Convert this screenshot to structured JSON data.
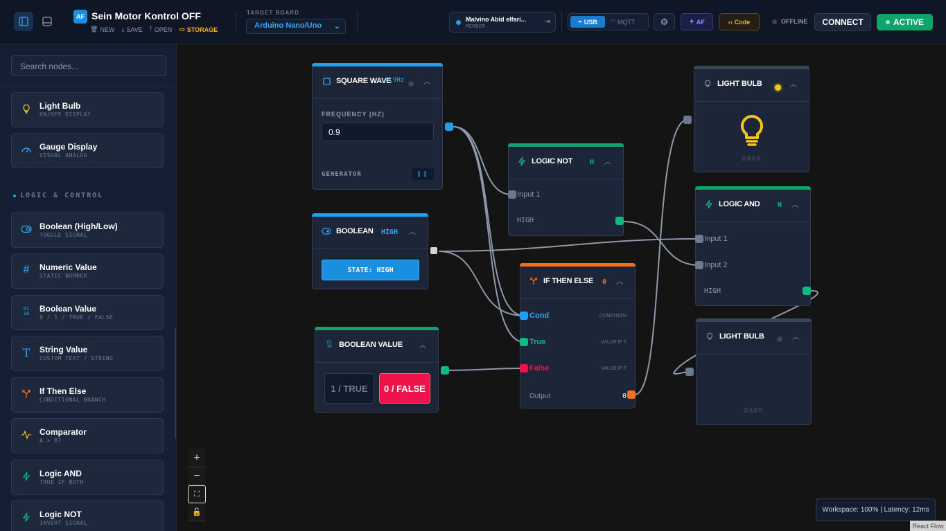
{
  "header": {
    "logo": "AF",
    "title": "Sein Motor Kontrol OFF",
    "actions": {
      "new": "NEW",
      "save": "SAVE",
      "open": "OPEN",
      "storage": "STORAGE"
    },
    "target_label": "TARGET BOARD",
    "target_value": "Arduino Nano/Uno",
    "user_name": "Malvino Abid elfari...",
    "user_role": "MEMBER",
    "usb": "USB",
    "mqtt": "MQTT",
    "af": "AF",
    "code": "Code",
    "status": "OFFLINE",
    "connect": "CONNECT",
    "active": "ACTIVE"
  },
  "sidebar": {
    "search_placeholder": "Search nodes...",
    "section_label": "LOGIC & CONTROL",
    "items": [
      {
        "name": "Light Bulb",
        "sub": "ON/OFF DISPLAY",
        "icon": "bulb-icon"
      },
      {
        "name": "Gauge Display",
        "sub": "VISUAL ANALOG",
        "icon": "gauge-icon"
      },
      {
        "name": "Boolean (High/Low)",
        "sub": "TOGGLE SIGNAL",
        "icon": "toggle-icon"
      },
      {
        "name": "Numeric Value",
        "sub": "STATIC NUMBER",
        "icon": "hash-icon"
      },
      {
        "name": "Boolean Value",
        "sub": "0 / 1 / TRUE / FALSE",
        "icon": "binary-icon"
      },
      {
        "name": "String Value",
        "sub": "CUSTOM TEXT / STRING",
        "icon": "text-icon"
      },
      {
        "name": "If Then Else",
        "sub": "CONDITIONAL BRANCH",
        "icon": "branch-icon"
      },
      {
        "name": "Comparator",
        "sub": "A > B?",
        "icon": "wave-icon"
      },
      {
        "name": "Logic AND",
        "sub": "TRUE IF BOTH",
        "icon": "bolt-icon"
      },
      {
        "name": "Logic NOT",
        "sub": "INVERT SIGNAL",
        "icon": "bolt-icon"
      }
    ]
  },
  "nodes": {
    "square_wave": {
      "title": "SQUARE WAVE",
      "badge": "0.9Hz",
      "freq_label": "FREQUENCY (HZ)",
      "freq_value": "0.9",
      "footer": "GENERATOR"
    },
    "boolean": {
      "title": "BOOLEAN",
      "badge": "HIGH",
      "state": "STATE: HIGH"
    },
    "boolean_value": {
      "title": "BOOLEAN VALUE",
      "true_label": "1 / TRUE",
      "false_label": "0 / FALSE"
    },
    "logic_not": {
      "title": "LOGIC NOT",
      "badge": "H",
      "input": "Input 1",
      "output": "HIGH"
    },
    "if_then_else": {
      "title": "IF THEN ELSE",
      "badge": "0",
      "cond": "Cond",
      "cond_hint": "CONDITION",
      "true_in": "True",
      "true_hint": "VALUE IF T",
      "false_in": "False",
      "false_hint": "VALUE IF F",
      "output": "Output",
      "output_val": "0"
    },
    "light_bulb_1": {
      "title": "LIGHT BULB",
      "state": "DARK"
    },
    "logic_and": {
      "title": "LOGIC AND",
      "badge": "H",
      "in1": "Input 1",
      "in2": "Input 2",
      "output": "HIGH"
    },
    "light_bulb_2": {
      "title": "LIGHT BULB",
      "state": "DARK"
    }
  },
  "status": "Workspace: 100% | Latency: 12ms",
  "attribution": "React Flow",
  "colors": {
    "accent": "#1ea1f2",
    "green": "#0fa56a",
    "orange": "#f2701c",
    "red": "#f0124a",
    "yellow": "#f5c518"
  }
}
